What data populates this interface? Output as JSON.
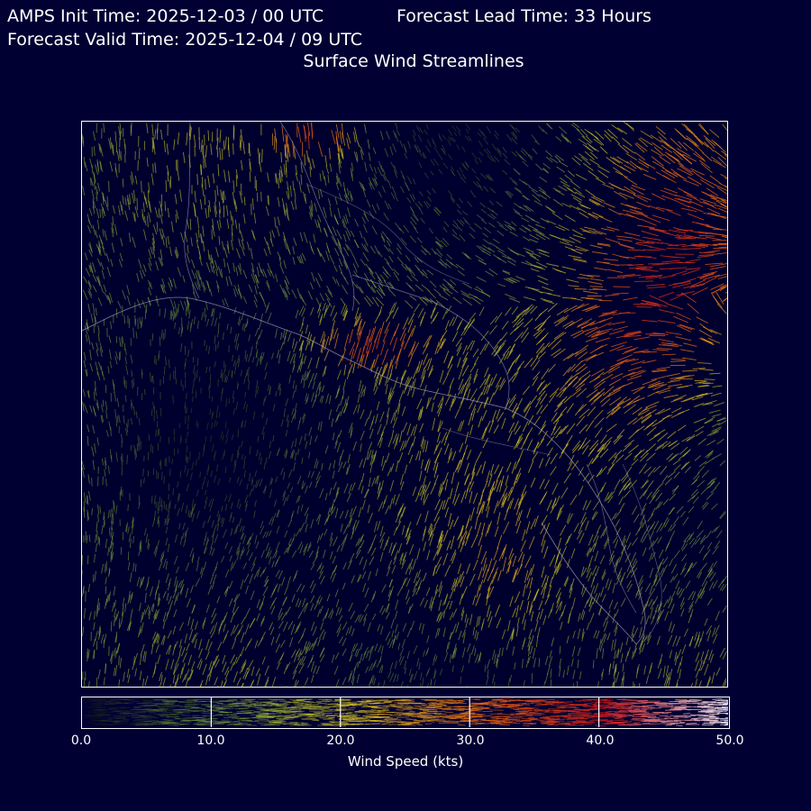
{
  "header": {
    "init_time": "AMPS Init Time: 2025-12-03 / 00 UTC",
    "lead_time": "Forecast Lead Time: 33 Hours",
    "valid_time": "Forecast Valid Time: 2025-12-04 / 09 UTC",
    "subtitle": "Surface Wind Streamlines"
  },
  "colorbar": {
    "label": "Wind Speed (kts)",
    "min": 0,
    "max": 50,
    "ticks": [
      "0.0",
      "10.0",
      "20.0",
      "30.0",
      "40.0",
      "50.0"
    ],
    "tick_values": [
      0,
      10,
      20,
      30,
      40,
      50
    ],
    "colors": {
      "calm": "#1a2410",
      "light": "#7fb040",
      "moderate": "#e0d020",
      "strong": "#e86a10",
      "very_strong": "#c81818",
      "extreme": "#f0f0ff"
    }
  },
  "map": {
    "background": "#000033",
    "coastline_color": "#9a9ab8"
  }
}
